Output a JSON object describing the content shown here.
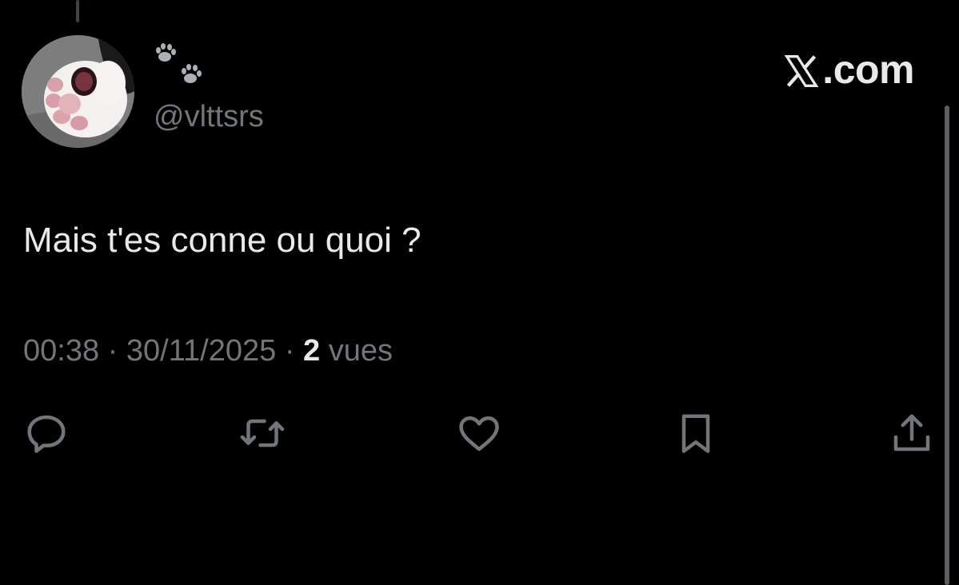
{
  "tweet": {
    "display_name_icon": "paw-prints-icon",
    "handle": "@vlttsrs",
    "text": "Mais t'es conne ou quoi ?",
    "time": "00:38",
    "date": "30/11/2025",
    "separator": "·",
    "views_count": "2",
    "views_label": "vues"
  },
  "brand": {
    "label": ".com",
    "icon": "x-logo-icon"
  },
  "actions": [
    {
      "name": "reply",
      "icon": "reply-icon"
    },
    {
      "name": "repost",
      "icon": "repost-icon"
    },
    {
      "name": "like",
      "icon": "heart-icon"
    },
    {
      "name": "bookmark",
      "icon": "bookmark-icon"
    },
    {
      "name": "share",
      "icon": "share-icon"
    }
  ],
  "colors": {
    "background": "#000000",
    "text_primary": "#e7e9ea",
    "text_secondary": "#71767b"
  }
}
